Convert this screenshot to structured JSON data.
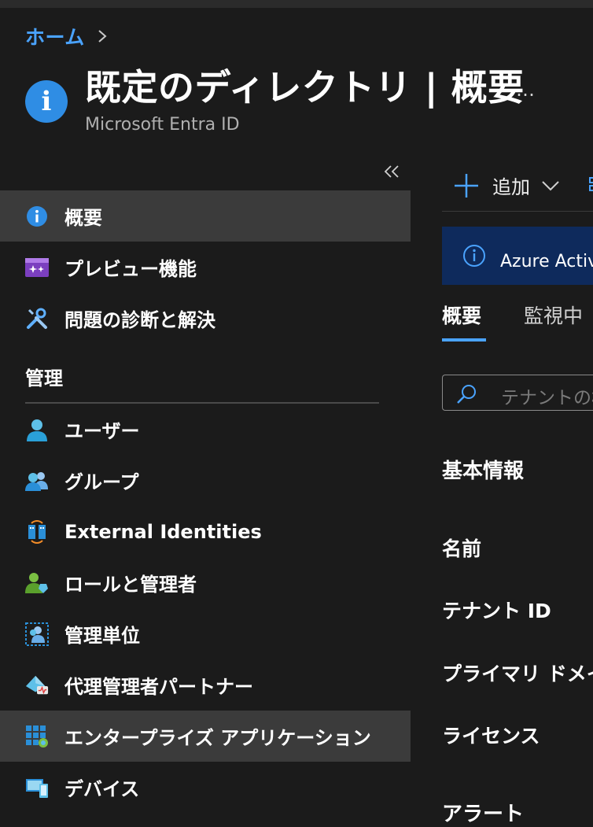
{
  "breadcrumb": {
    "home": "ホーム"
  },
  "header": {
    "title": "既定のディレクトリ | 概要",
    "subtitle": "Microsoft Entra ID",
    "more": "…"
  },
  "nav": {
    "items_top": [
      {
        "label": "概要",
        "icon": "info-icon",
        "selected": true
      },
      {
        "label": "プレビュー機能",
        "icon": "preview-features-icon"
      },
      {
        "label": "問題の診断と解決",
        "icon": "wrench-icon"
      }
    ],
    "section": "管理",
    "items_manage": [
      {
        "label": "ユーザー",
        "icon": "user-icon"
      },
      {
        "label": "グループ",
        "icon": "group-icon"
      },
      {
        "label": "External Identities",
        "icon": "external-identities-icon"
      },
      {
        "label": "ロールと管理者",
        "icon": "roles-icon"
      },
      {
        "label": "管理単位",
        "icon": "admin-units-icon"
      },
      {
        "label": "代理管理者パートナー",
        "icon": "delegated-partner-icon"
      },
      {
        "label": "エンタープライズ アプリケーション",
        "icon": "enterprise-apps-icon",
        "selected": true
      },
      {
        "label": "デバイス",
        "icon": "devices-icon"
      }
    ]
  },
  "commandbar": {
    "add": "追加"
  },
  "banner": {
    "text": "Azure Active Directory は Microsoft Entra ID になりました"
  },
  "tabs": [
    {
      "label": "概要",
      "active": true
    },
    {
      "label": "監視中"
    }
  ],
  "search": {
    "placeholder": "テナントの検索"
  },
  "basic_info": {
    "title": "基本情報",
    "props": [
      "名前",
      "テナント ID",
      "プライマリ ドメイン",
      "ライセンス"
    ]
  },
  "alerts": {
    "title": "アラート"
  },
  "colors": {
    "accent": "#4aa3ff",
    "background": "#1b1b1b",
    "selected": "#3b3b3b",
    "banner": "#0e2a5c"
  }
}
